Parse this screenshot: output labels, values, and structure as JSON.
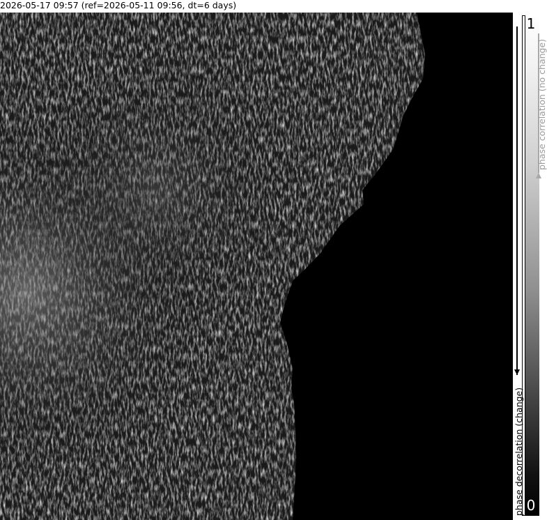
{
  "header": {
    "title": "2026-05-17 09:57 (ref=2026-05-11 09:56, dt=6 days)"
  },
  "colorbar": {
    "top_label": "1",
    "bottom_label": "0",
    "upper_axis_label": "phase correlation (no change)",
    "lower_axis_label": "phase decorrelation (change)",
    "upper_arrow_color": "#a8a8a8",
    "lower_arrow_color": "#000000"
  },
  "image": {
    "description_icon": "coherence-map-image",
    "background_color": "#000000"
  }
}
